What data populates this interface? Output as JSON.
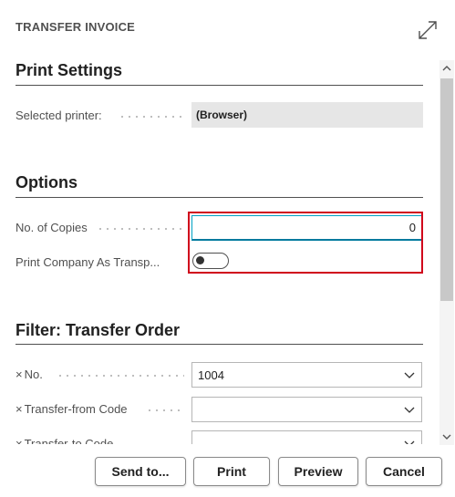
{
  "dialog": {
    "title": "TRANSFER INVOICE"
  },
  "print_settings": {
    "title": "Print Settings",
    "selected_printer_label": "Selected printer:",
    "selected_printer_value": "(Browser)"
  },
  "options": {
    "title": "Options",
    "copies_label": "No. of Copies",
    "copies_value": "0",
    "print_company_label": "Print Company As Transp...",
    "print_company_value": false
  },
  "filter": {
    "title": "Filter: Transfer Order",
    "fields": [
      {
        "label": "No.",
        "value": "1004"
      },
      {
        "label": "Transfer-from Code",
        "value": ""
      },
      {
        "label": "Transfer-to Code",
        "value": ""
      }
    ]
  },
  "buttons": {
    "send_to": "Send to...",
    "print": "Print",
    "preview": "Preview",
    "cancel": "Cancel"
  },
  "icons": {
    "expand": "expand-icon",
    "remove": "close-icon",
    "dropdown": "chevron-down-icon",
    "scroll_up": "chevron-up-icon",
    "scroll_down": "chevron-down-icon"
  },
  "colors": {
    "highlight_border": "#d0021b",
    "focus_border": "#00a1c4"
  }
}
